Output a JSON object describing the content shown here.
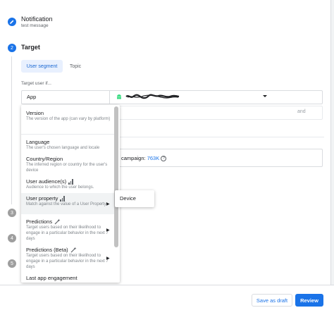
{
  "steps": {
    "notification": {
      "title": "Notification",
      "subtitle": "test message"
    },
    "target": {
      "number": "2",
      "title": "Target"
    },
    "collapsed": [
      "3",
      "4",
      "5"
    ]
  },
  "tabs": [
    {
      "label": "User segment",
      "selected": true
    },
    {
      "label": "Topic",
      "selected": false
    }
  ],
  "target_label": "Target user if...",
  "row": {
    "field_label": "App",
    "app_icon": "android-icon",
    "and_label": "and"
  },
  "campaign": {
    "prefix": "campaign: ",
    "count": "763K",
    "help_icon": "help-icon"
  },
  "menu": {
    "items": [
      {
        "title": "Version",
        "desc": "The version of the app (can vary by platform)"
      },
      {
        "title": "Language",
        "desc": "The user's chosen language and locale"
      },
      {
        "title": "Country/Region",
        "desc": "The inferred region or country for the user's device"
      },
      {
        "title": "User audience(s)",
        "desc": "Audience to which the user belongs.",
        "icon": "signal-bars-icon"
      },
      {
        "title": "User property",
        "desc": "Match against the value of a User Property",
        "icon": "signal-bars-icon"
      },
      {
        "title": "Predictions",
        "desc": "Target users based on their likelihood to engage in a particular behavior in the next 7 days",
        "icon": "magic-wand-icon"
      },
      {
        "title": "Predictions (Beta)",
        "desc": "Target users based on their likelihood to engage in a particular behavior in the next 7 days",
        "icon": "magic-wand-icon"
      },
      {
        "title": "Last app engagement"
      }
    ],
    "submenu_item": "Device"
  },
  "footer": {
    "save_draft": "Save as draft",
    "review": "Review"
  },
  "colors": {
    "accent": "#1a73e8",
    "selected_tab_bg": "#e8f0fe",
    "android_green": "#3ddc84"
  }
}
